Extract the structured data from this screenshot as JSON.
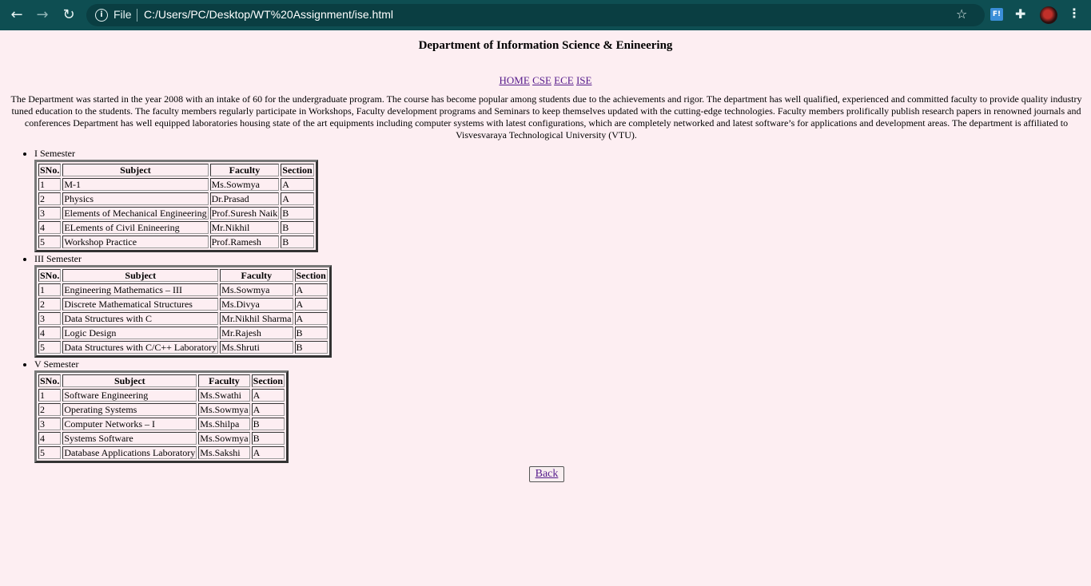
{
  "browser": {
    "url": "C:/Users/PC/Desktop/WT%20Assignment/ise.html",
    "scheme_label": "File",
    "extension_label": "F!",
    "icons": [
      "back-arrow-icon",
      "forward-arrow-icon",
      "reload-icon",
      "info-icon",
      "star-icon",
      "extension-icon",
      "puzzle-icon",
      "avatar",
      "kebab-menu-icon"
    ]
  },
  "page": {
    "title": "Department of Information Science & Enineering",
    "nav": [
      "HOME",
      "CSE",
      "ECE",
      "ISE"
    ],
    "intro": "The Department was started in the year 2008 with an intake of 60 for the undergraduate program. The course has become popular among students due to the achievements and rigor. The department has well qualified, experienced and committed faculty to provide quality industry tuned education to the students. The faculty members regularly participate in Workshops, Faculty development programs and Seminars to keep themselves updated with the cutting-edge technologies. Faculty members prolifically publish research papers in renowned journals and conferences Department has well equipped laboratories housing state of the art equipments including computer systems with latest configurations, which are completely networked and latest software’s for applications and development areas. The department is affiliated to Visvesvaraya Technological University (VTU).",
    "table_headers": [
      "SNo.",
      "Subject",
      "Faculty",
      "Section"
    ],
    "semesters": [
      {
        "label": "I Semester",
        "rows": [
          [
            "1",
            "M-1",
            "Ms.Sowmya",
            "A"
          ],
          [
            "2",
            "Physics",
            "Dr.Prasad",
            "A"
          ],
          [
            "3",
            "Elements of Mechanical Engineering",
            "Prof.Suresh Naik",
            "B"
          ],
          [
            "4",
            "ELements of Civil Enineering",
            "Mr.Nikhil",
            "B"
          ],
          [
            "5",
            "Workshop Practice",
            "Prof.Ramesh",
            "B"
          ]
        ]
      },
      {
        "label": "III Semester",
        "rows": [
          [
            "1",
            "Engineering Mathematics – III",
            "Ms.Sowmya",
            "A"
          ],
          [
            "2",
            "Discrete Mathematical Structures",
            "Ms.Divya",
            "A"
          ],
          [
            "3",
            "Data Structures with C",
            "Mr.Nikhil Sharma",
            "A"
          ],
          [
            "4",
            "Logic Design",
            "Mr.Rajesh",
            "B"
          ],
          [
            "5",
            "Data Structures with C/C++ Laboratory",
            "Ms.Shruti",
            "B"
          ]
        ]
      },
      {
        "label": "V Semester",
        "rows": [
          [
            "1",
            "Software Engineering",
            "Ms.Swathi",
            "A"
          ],
          [
            "2",
            "Operating Systems",
            "Ms.Sowmya",
            "A"
          ],
          [
            "3",
            "Computer Networks – I",
            "Ms.Shilpa",
            "B"
          ],
          [
            "4",
            "Systems Software",
            "Ms.Sowmya",
            "B"
          ],
          [
            "5",
            "Database Applications Laboratory",
            "Ms.Sakshi",
            "A"
          ]
        ]
      }
    ],
    "back_label": "Back"
  }
}
